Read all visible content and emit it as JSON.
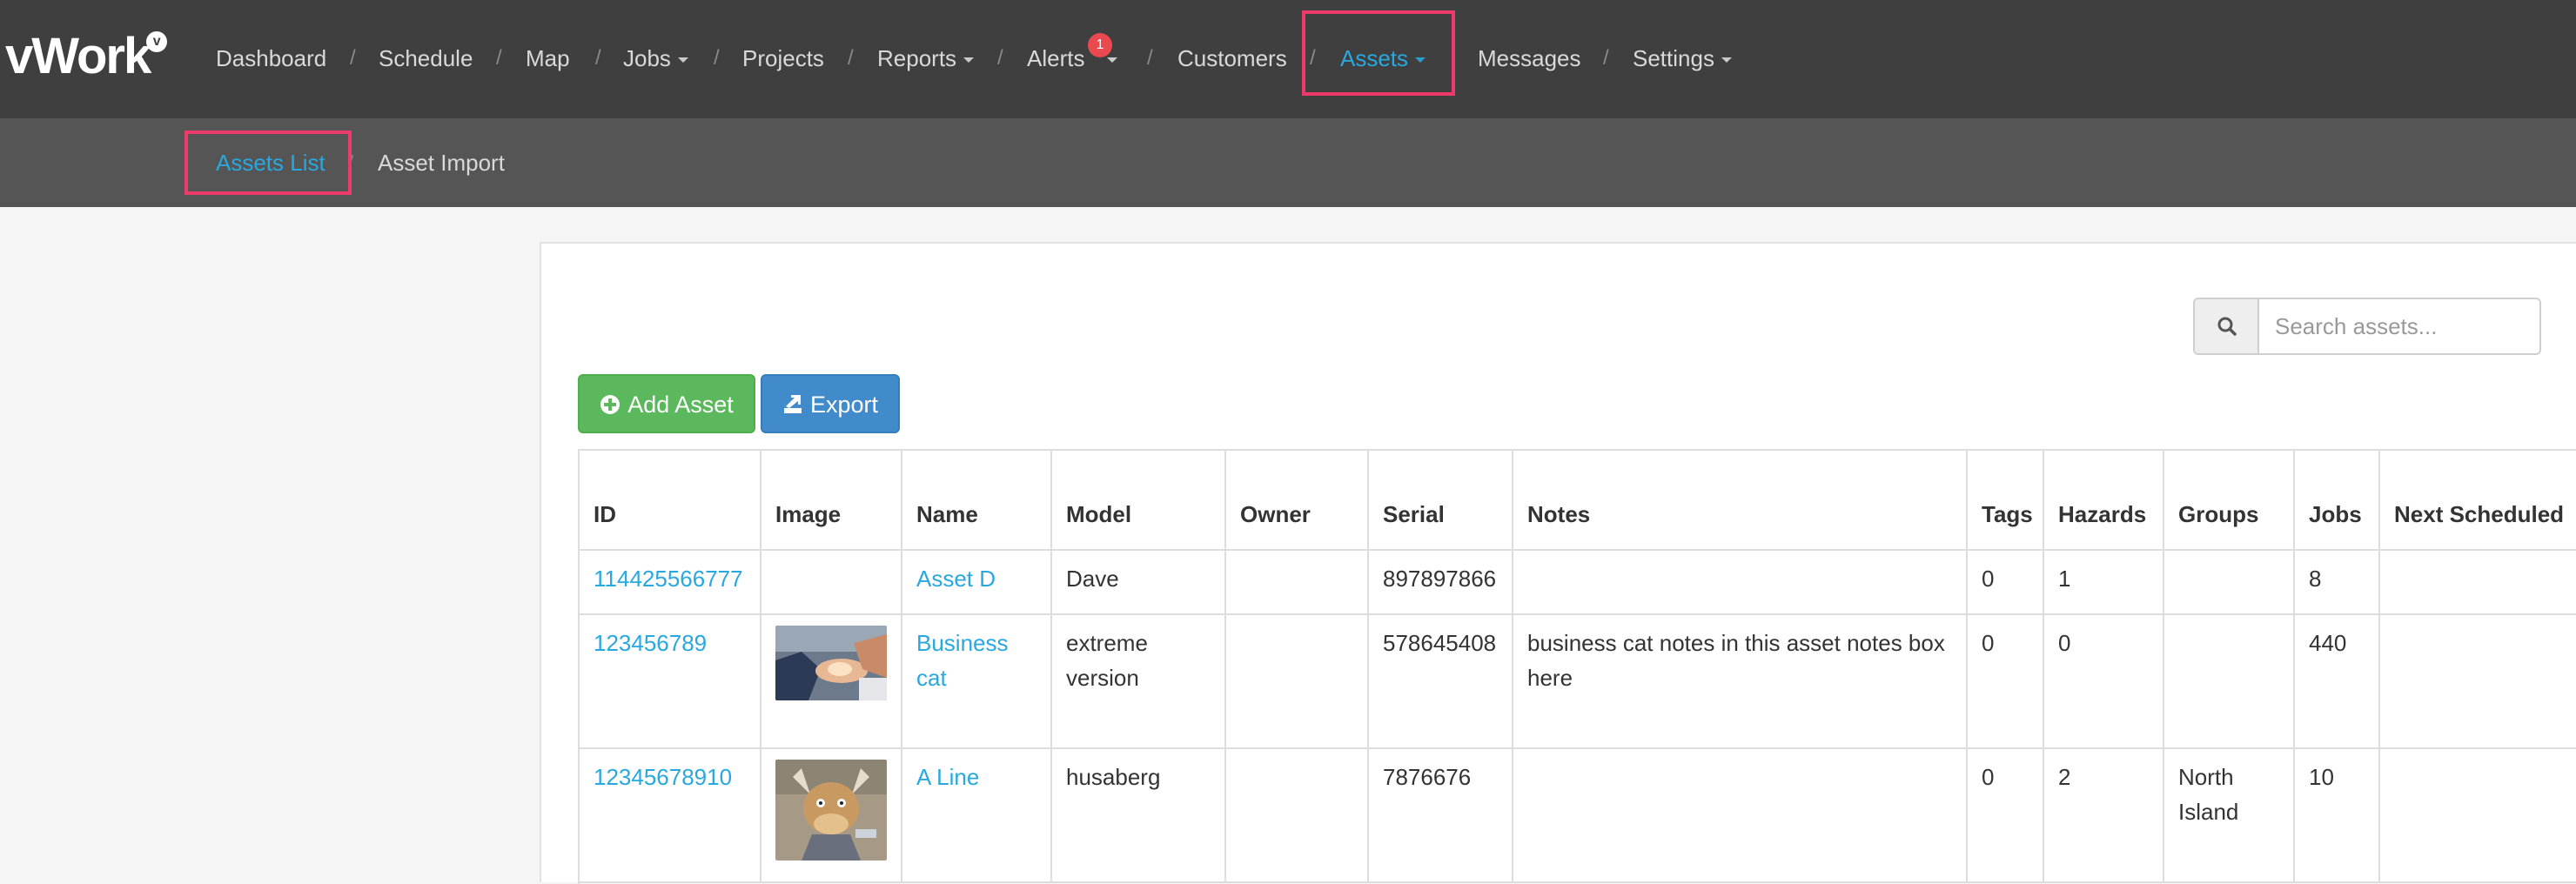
{
  "brand": {
    "name": "vWork",
    "badge": "v"
  },
  "nav": {
    "items": [
      {
        "label": "Dashboard"
      },
      {
        "label": "Schedule"
      },
      {
        "label": "Map"
      },
      {
        "label": "Jobs"
      },
      {
        "label": "Projects"
      },
      {
        "label": "Reports"
      },
      {
        "label": "Alerts",
        "badge": "1"
      },
      {
        "label": "Customers"
      },
      {
        "label": "Assets"
      },
      {
        "label": "Messages"
      },
      {
        "label": "Settings"
      }
    ],
    "separator": "/",
    "active": "Assets"
  },
  "subnav": {
    "items": [
      {
        "label": "Assets List"
      },
      {
        "label": "Asset Import"
      }
    ],
    "active": "Assets List"
  },
  "search": {
    "placeholder": "Search assets...",
    "value": ""
  },
  "actions": {
    "add_label": "Add Asset",
    "export_label": "Export"
  },
  "table": {
    "headers": [
      "ID",
      "Image",
      "Name",
      "Model",
      "Owner",
      "Serial",
      "Notes",
      "Tags",
      "Hazards",
      "Groups",
      "Jobs",
      "Next Scheduled"
    ],
    "rows": [
      {
        "id": "114425566777",
        "image": "",
        "name": "Asset D",
        "model": "Dave",
        "owner": "",
        "serial": "897897866",
        "notes": "",
        "tags": "0",
        "hazards": "1",
        "groups": "",
        "jobs": "8",
        "next": ""
      },
      {
        "id": "123456789",
        "image": "business-cat-photo",
        "name": "Business cat",
        "model": "extreme version",
        "owner": "",
        "serial": "578645408",
        "notes": "business cat notes in this asset notes box here",
        "tags": "0",
        "hazards": "0",
        "groups": "",
        "jobs": "440",
        "next": ""
      },
      {
        "id": "12345678910",
        "image": "cartoon-bull-photo",
        "name": "A Line",
        "model": "husaberg",
        "owner": "",
        "serial": "7876676",
        "notes": "",
        "tags": "0",
        "hazards": "2",
        "groups": "North Island",
        "jobs": "10",
        "next": ""
      }
    ]
  },
  "colors": {
    "navbar_bg": "#3f3f3f",
    "subbar_bg": "#555555",
    "accent": "#29a8df",
    "highlight": "#ec3a6b",
    "add_button": "#5cb85c",
    "export_button": "#428bca",
    "alert_badge": "#e9494f"
  }
}
